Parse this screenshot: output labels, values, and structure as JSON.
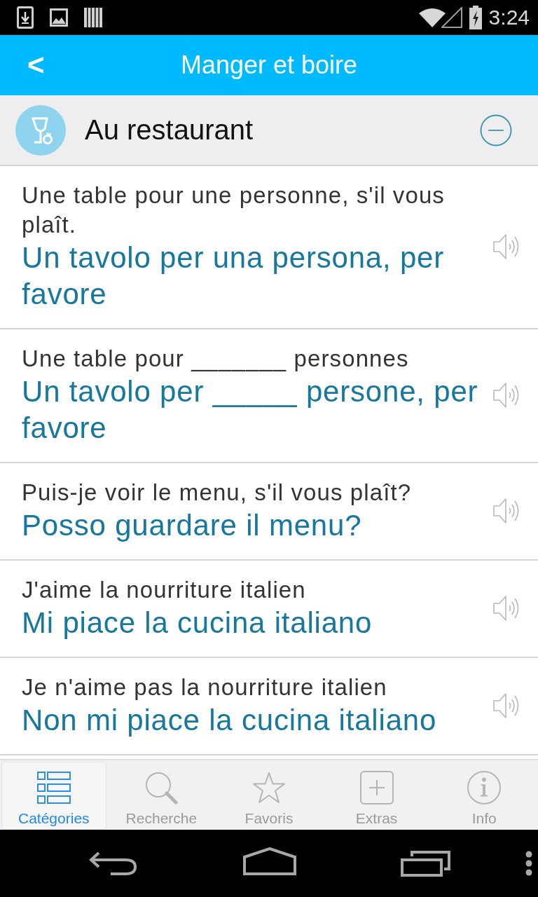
{
  "status_bar": {
    "time": "3:24"
  },
  "app_bar": {
    "back": "<",
    "title": "Manger et boire"
  },
  "section": {
    "title": "Au restaurant",
    "expanded": true
  },
  "phrases": [
    {
      "source": "Une table pour une personne, s'il vous plaît.",
      "translation": "Un tavolo per una persona, per favore"
    },
    {
      "source": "Une table pour _______ personnes",
      "translation": "Un tavolo per _____ persone, per favore"
    },
    {
      "source": "Puis-je voir le menu, s'il vous plaît?",
      "translation": "Posso guardare il menu?"
    },
    {
      "source": "J'aime la nourriture italien",
      "translation": "Mi piace la cucina italiano"
    },
    {
      "source": "Je n'aime pas la nourriture italien",
      "translation": "Non mi piace la cucina italiano"
    }
  ],
  "tabs": [
    {
      "kind": "categories",
      "label": "Catégories",
      "selected": true
    },
    {
      "kind": "search",
      "label": "Recherche",
      "selected": false
    },
    {
      "kind": "favorites",
      "label": "Favoris",
      "selected": false
    },
    {
      "kind": "extras",
      "label": "Extras",
      "selected": false
    },
    {
      "kind": "info",
      "label": "Info",
      "selected": false
    }
  ]
}
